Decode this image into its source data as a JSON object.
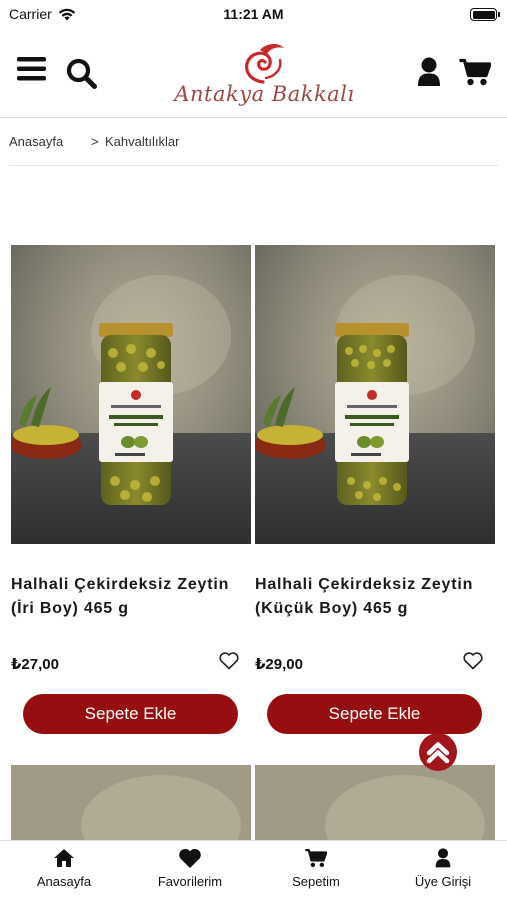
{
  "status": {
    "carrier": "Carrier",
    "time": "11:21 AM"
  },
  "header": {
    "logo_text": "Antakya Bakkalı",
    "icons": [
      "menu-icon",
      "search-icon",
      "user-icon",
      "cart-icon"
    ]
  },
  "breadcrumb": {
    "home": "Anasayfa",
    "separator": ">",
    "current": "Kahvaltılıklar"
  },
  "products": [
    {
      "title": "Halhali Çekirdeksiz Zeytin (İri Boy) 465 g",
      "price": "₺27,00",
      "button": "Sepete Ekle"
    },
    {
      "title": "Halhali Çekirdeksiz Zeytin (Küçük Boy) 465 g",
      "price": "₺29,00",
      "button": "Sepete Ekle"
    }
  ],
  "tabbar": {
    "items": [
      {
        "label": "Anasayfa",
        "icon": "home-icon"
      },
      {
        "label": "Favorilerim",
        "icon": "heart-icon"
      },
      {
        "label": "Sepetim",
        "icon": "cart-icon"
      },
      {
        "label": "Üye Girişi",
        "icon": "user-icon"
      }
    ]
  },
  "colors": {
    "brand": "#960e10",
    "logo": "#9a4a42",
    "logo_accent": "#c62a2a"
  }
}
